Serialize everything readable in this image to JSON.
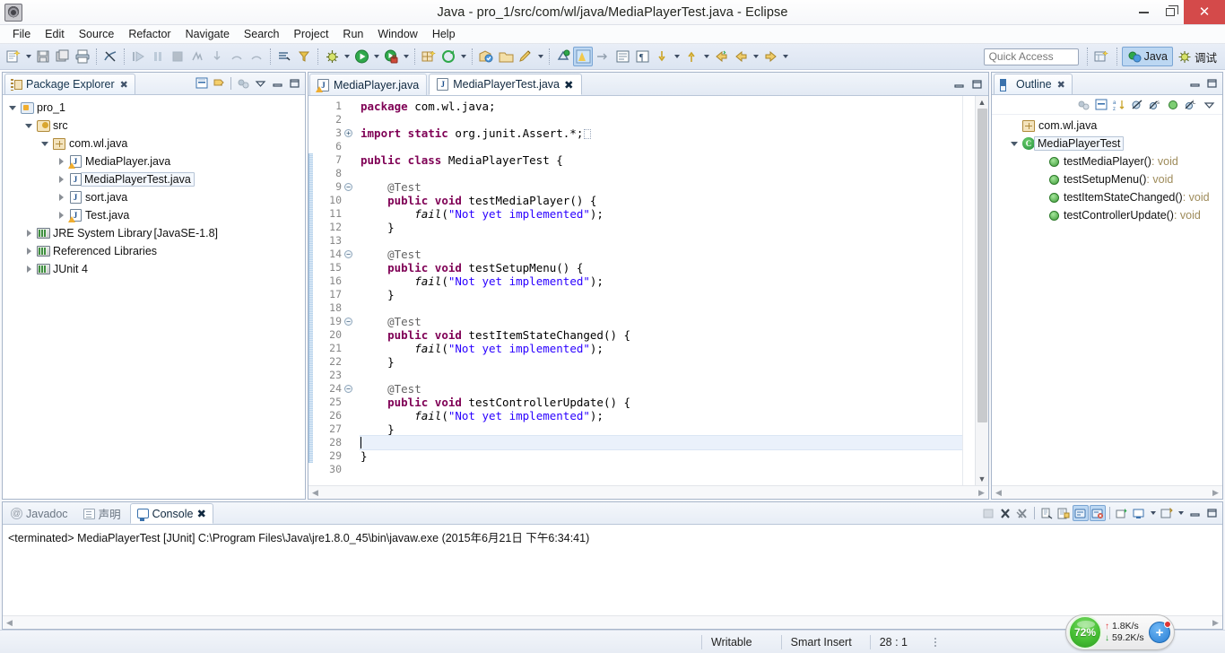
{
  "window": {
    "title": "Java - pro_1/src/com/wl/java/MediaPlayerTest.java - Eclipse",
    "app_icon_name": "eclipse-icon",
    "minimize_label": "Minimize",
    "maximize_label": "Restore",
    "close_label": "Close",
    "close_glyph": "✕"
  },
  "menubar": {
    "items": [
      {
        "label": "File"
      },
      {
        "label": "Edit"
      },
      {
        "label": "Source"
      },
      {
        "label": "Refactor"
      },
      {
        "label": "Navigate"
      },
      {
        "label": "Search"
      },
      {
        "label": "Project"
      },
      {
        "label": "Run"
      },
      {
        "label": "Window"
      },
      {
        "label": "Help"
      }
    ]
  },
  "toolbar": {
    "quick_access_placeholder": "Quick Access",
    "quick_access_value": "",
    "perspectives": [
      {
        "label": "Java",
        "active": true
      },
      {
        "label": "调试",
        "active": false
      }
    ],
    "open_perspective_tooltip": "Open Perspective"
  },
  "package_explorer": {
    "tab_label": "Package Explorer",
    "close_glyph": "✖",
    "tools": [
      "collapse-all-icon",
      "link-with-editor-icon",
      "view-menu-icon",
      "filter-icon",
      "minimize-icon",
      "maximize-icon"
    ],
    "tree": [
      {
        "label": "pro_1",
        "indent": 0,
        "twisty": "expanded",
        "icon": "java-project-icon",
        "selected": false,
        "suffix": ""
      },
      {
        "label": "src",
        "indent": 1,
        "twisty": "expanded",
        "icon": "source-folder-icon",
        "selected": false,
        "suffix": ""
      },
      {
        "label": "com.wl.java",
        "indent": 2,
        "twisty": "expanded",
        "icon": "package-icon",
        "selected": false,
        "suffix": ""
      },
      {
        "label": "MediaPlayer.java",
        "indent": 3,
        "twisty": "collapsed",
        "icon": "java-file-warning-icon",
        "selected": false,
        "suffix": ""
      },
      {
        "label": "MediaPlayerTest.java",
        "indent": 3,
        "twisty": "collapsed",
        "icon": "java-file-icon",
        "selected": true,
        "suffix": ""
      },
      {
        "label": "sort.java",
        "indent": 3,
        "twisty": "collapsed",
        "icon": "java-file-icon",
        "selected": false,
        "suffix": ""
      },
      {
        "label": "Test.java",
        "indent": 3,
        "twisty": "collapsed",
        "icon": "java-file-warning-icon",
        "selected": false,
        "suffix": ""
      },
      {
        "label": "JRE System Library",
        "indent": 1,
        "twisty": "collapsed",
        "icon": "library-icon",
        "selected": false,
        "suffix": "[JavaSE-1.8]"
      },
      {
        "label": "Referenced Libraries",
        "indent": 1,
        "twisty": "collapsed",
        "icon": "library-icon",
        "selected": false,
        "suffix": ""
      },
      {
        "label": "JUnit 4",
        "indent": 1,
        "twisty": "collapsed",
        "icon": "library-icon",
        "selected": false,
        "suffix": ""
      }
    ]
  },
  "editor": {
    "tabs": [
      {
        "label": "MediaPlayer.java",
        "active": false,
        "icon": "java-file-warning-icon",
        "closable": false
      },
      {
        "label": "MediaPlayerTest.java",
        "active": true,
        "icon": "java-file-icon",
        "closable": true,
        "close_glyph": "✖"
      }
    ],
    "minimize_label": "Minimize",
    "maximize_label": "Maximize",
    "lines": [
      {
        "num": "1",
        "fold": "",
        "changed": false,
        "current": false,
        "tokens": [
          {
            "t": "kw",
            "v": "package"
          },
          {
            "t": "p",
            "v": " com.wl.java;"
          }
        ]
      },
      {
        "num": "2",
        "fold": "",
        "changed": false,
        "current": false,
        "tokens": []
      },
      {
        "num": "3",
        "fold": "plus",
        "changed": false,
        "current": false,
        "tokens": [
          {
            "t": "kw",
            "v": "import static"
          },
          {
            "t": "p",
            "v": " org.junit.Assert.*;"
          },
          {
            "t": "box",
            "v": ""
          }
        ]
      },
      {
        "num": "6",
        "fold": "",
        "changed": false,
        "current": false,
        "tokens": []
      },
      {
        "num": "7",
        "fold": "",
        "changed": true,
        "current": false,
        "tokens": [
          {
            "t": "kw",
            "v": "public class"
          },
          {
            "t": "p",
            "v": " MediaPlayerTest {"
          }
        ]
      },
      {
        "num": "8",
        "fold": "",
        "changed": true,
        "current": false,
        "tokens": []
      },
      {
        "num": "9",
        "fold": "minus",
        "changed": true,
        "current": false,
        "tokens": [
          {
            "t": "p",
            "v": "    "
          },
          {
            "t": "ann",
            "v": "@Test"
          }
        ]
      },
      {
        "num": "10",
        "fold": "",
        "changed": true,
        "current": false,
        "tokens": [
          {
            "t": "p",
            "v": "    "
          },
          {
            "t": "kw",
            "v": "public"
          },
          {
            "t": "p",
            "v": " "
          },
          {
            "t": "kw",
            "v": "void"
          },
          {
            "t": "p",
            "v": " testMediaPlayer() {"
          }
        ]
      },
      {
        "num": "11",
        "fold": "",
        "changed": true,
        "current": false,
        "tokens": [
          {
            "t": "p",
            "v": "        "
          },
          {
            "t": "mth",
            "v": "fail"
          },
          {
            "t": "p",
            "v": "("
          },
          {
            "t": "str",
            "v": "\"Not yet implemented\""
          },
          {
            "t": "p",
            "v": ");"
          }
        ]
      },
      {
        "num": "12",
        "fold": "",
        "changed": true,
        "current": false,
        "tokens": [
          {
            "t": "p",
            "v": "    }"
          }
        ]
      },
      {
        "num": "13",
        "fold": "",
        "changed": true,
        "current": false,
        "tokens": []
      },
      {
        "num": "14",
        "fold": "minus",
        "changed": true,
        "current": false,
        "tokens": [
          {
            "t": "p",
            "v": "    "
          },
          {
            "t": "ann",
            "v": "@Test"
          }
        ]
      },
      {
        "num": "15",
        "fold": "",
        "changed": true,
        "current": false,
        "tokens": [
          {
            "t": "p",
            "v": "    "
          },
          {
            "t": "kw",
            "v": "public"
          },
          {
            "t": "p",
            "v": " "
          },
          {
            "t": "kw",
            "v": "void"
          },
          {
            "t": "p",
            "v": " testSetupMenu() {"
          }
        ]
      },
      {
        "num": "16",
        "fold": "",
        "changed": true,
        "current": false,
        "tokens": [
          {
            "t": "p",
            "v": "        "
          },
          {
            "t": "mth",
            "v": "fail"
          },
          {
            "t": "p",
            "v": "("
          },
          {
            "t": "str",
            "v": "\"Not yet implemented\""
          },
          {
            "t": "p",
            "v": ");"
          }
        ]
      },
      {
        "num": "17",
        "fold": "",
        "changed": true,
        "current": false,
        "tokens": [
          {
            "t": "p",
            "v": "    }"
          }
        ]
      },
      {
        "num": "18",
        "fold": "",
        "changed": true,
        "current": false,
        "tokens": []
      },
      {
        "num": "19",
        "fold": "minus",
        "changed": true,
        "current": false,
        "tokens": [
          {
            "t": "p",
            "v": "    "
          },
          {
            "t": "ann",
            "v": "@Test"
          }
        ]
      },
      {
        "num": "20",
        "fold": "",
        "changed": true,
        "current": false,
        "tokens": [
          {
            "t": "p",
            "v": "    "
          },
          {
            "t": "kw",
            "v": "public"
          },
          {
            "t": "p",
            "v": " "
          },
          {
            "t": "kw",
            "v": "void"
          },
          {
            "t": "p",
            "v": " testItemStateChanged() {"
          }
        ]
      },
      {
        "num": "21",
        "fold": "",
        "changed": true,
        "current": false,
        "tokens": [
          {
            "t": "p",
            "v": "        "
          },
          {
            "t": "mth",
            "v": "fail"
          },
          {
            "t": "p",
            "v": "("
          },
          {
            "t": "str",
            "v": "\"Not yet implemented\""
          },
          {
            "t": "p",
            "v": ");"
          }
        ]
      },
      {
        "num": "22",
        "fold": "",
        "changed": true,
        "current": false,
        "tokens": [
          {
            "t": "p",
            "v": "    }"
          }
        ]
      },
      {
        "num": "23",
        "fold": "",
        "changed": true,
        "current": false,
        "tokens": []
      },
      {
        "num": "24",
        "fold": "minus",
        "changed": true,
        "current": false,
        "tokens": [
          {
            "t": "p",
            "v": "    "
          },
          {
            "t": "ann",
            "v": "@Test"
          }
        ]
      },
      {
        "num": "25",
        "fold": "",
        "changed": true,
        "current": false,
        "tokens": [
          {
            "t": "p",
            "v": "    "
          },
          {
            "t": "kw",
            "v": "public"
          },
          {
            "t": "p",
            "v": " "
          },
          {
            "t": "kw",
            "v": "void"
          },
          {
            "t": "p",
            "v": " testControllerUpdate() {"
          }
        ]
      },
      {
        "num": "26",
        "fold": "",
        "changed": true,
        "current": false,
        "tokens": [
          {
            "t": "p",
            "v": "        "
          },
          {
            "t": "mth",
            "v": "fail"
          },
          {
            "t": "p",
            "v": "("
          },
          {
            "t": "str",
            "v": "\"Not yet implemented\""
          },
          {
            "t": "p",
            "v": ");"
          }
        ]
      },
      {
        "num": "27",
        "fold": "",
        "changed": true,
        "current": false,
        "tokens": [
          {
            "t": "p",
            "v": "    }"
          }
        ]
      },
      {
        "num": "28",
        "fold": "",
        "changed": true,
        "current": true,
        "tokens": [
          {
            "t": "caret",
            "v": ""
          }
        ]
      },
      {
        "num": "29",
        "fold": "",
        "changed": true,
        "current": false,
        "tokens": [
          {
            "t": "p",
            "v": "}"
          }
        ]
      },
      {
        "num": "30",
        "fold": "",
        "changed": false,
        "current": false,
        "tokens": []
      }
    ]
  },
  "outline": {
    "tab_label": "Outline",
    "close_glyph": "✖",
    "tools": [
      "focus-icon",
      "collapse-all-icon",
      "sort-icon",
      "hide-fields-icon",
      "hide-static-icon",
      "hide-nonpublic-icon",
      "hide-local-icon",
      "view-menu-icon"
    ],
    "items": [
      {
        "label": "com.wl.java",
        "indent": 0,
        "twisty": "",
        "icon": "package-icon",
        "rettype": "",
        "selected": false
      },
      {
        "label": "MediaPlayerTest",
        "indent": 0,
        "twisty": "expanded",
        "icon": "class-icon",
        "rettype": "",
        "selected": true
      },
      {
        "label": "testMediaPlayer()",
        "indent": 1,
        "twisty": "",
        "icon": "method-icon",
        "rettype": ": void",
        "selected": false
      },
      {
        "label": "testSetupMenu()",
        "indent": 1,
        "twisty": "",
        "icon": "method-icon",
        "rettype": ": void",
        "selected": false
      },
      {
        "label": "testItemStateChanged()",
        "indent": 1,
        "twisty": "",
        "icon": "method-icon",
        "rettype": ": void",
        "selected": false
      },
      {
        "label": "testControllerUpdate()",
        "indent": 1,
        "twisty": "",
        "icon": "method-icon",
        "rettype": ": void",
        "selected": false
      }
    ]
  },
  "console": {
    "tabs": [
      {
        "label": "Javadoc",
        "active": false,
        "icon": "javadoc-icon"
      },
      {
        "label": "声明",
        "active": false,
        "icon": "declaration-icon"
      },
      {
        "label": "Console",
        "active": true,
        "icon": "console-icon",
        "close_glyph": "✖"
      }
    ],
    "output": "<terminated> MediaPlayerTest [JUnit] C:\\Program Files\\Java\\jre1.8.0_45\\bin\\javaw.exe (2015年6月21日 下午6:34:41)",
    "tools": [
      "terminate-icon",
      "remove-launch-icon",
      "remove-all-terminated-icon",
      "clear-console-icon",
      "scroll-lock-icon",
      "word-wrap-icon",
      "pin-console-icon",
      "display-selected-console-icon",
      "open-console-icon",
      "minimize-icon",
      "maximize-icon"
    ]
  },
  "statusbar": {
    "writable": "Writable",
    "insert_mode": "Smart Insert",
    "position": "28 : 1"
  },
  "net_widget": {
    "percent": "72%",
    "upload": "1.8K/s",
    "download": "59.2K/s",
    "up_glyph": "↑",
    "down_glyph": "↓",
    "plus_glyph": "+"
  },
  "colors": {
    "accent": "#3b72ad",
    "keyword": "#7f0055",
    "string": "#2a00ff",
    "annotation": "#646464",
    "close_button": "#d44a4a",
    "net_green": "#46bf33"
  }
}
